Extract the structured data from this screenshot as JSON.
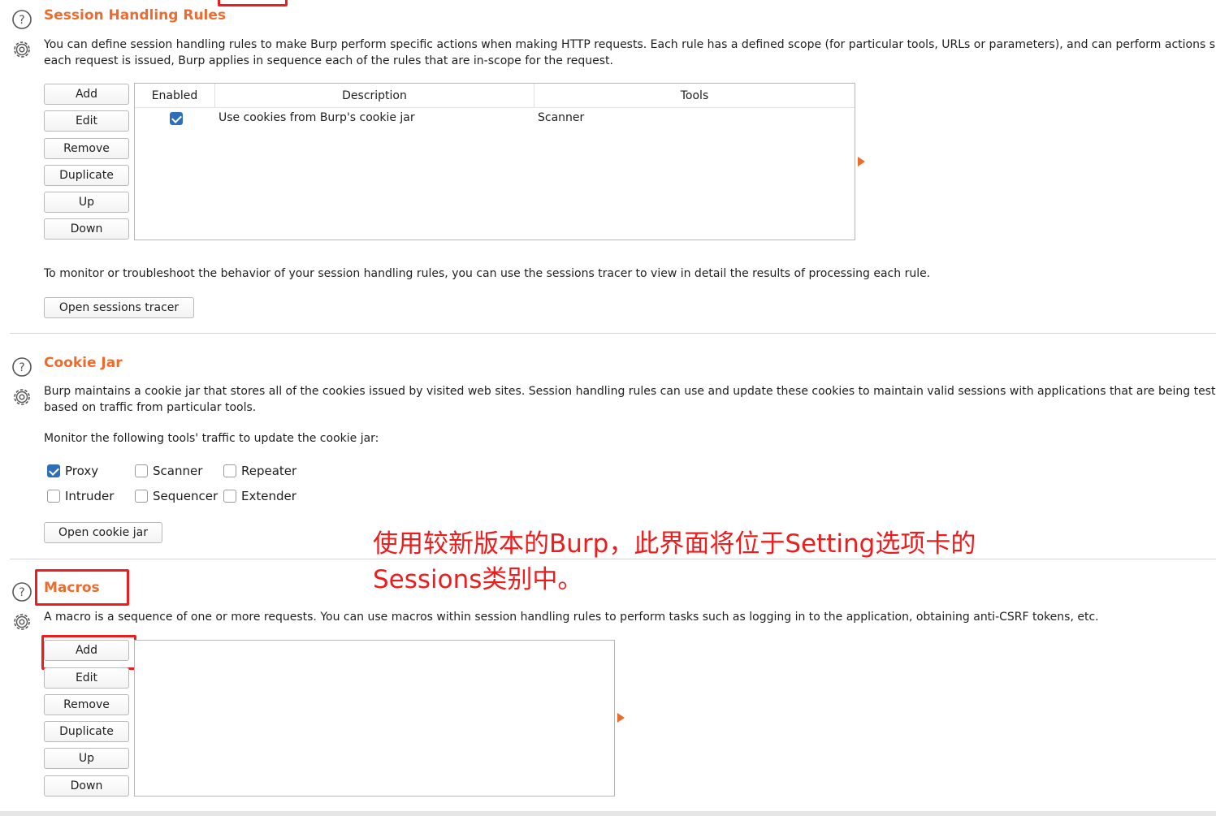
{
  "session_rules": {
    "title": "Session Handling Rules",
    "desc_line1": "You can define session handling rules to make Burp perform specific actions when making HTTP requests. Each rule has a defined scope (for particular tools, URLs or parameters), and can perform actions su",
    "desc_line2": "each request is issued, Burp applies in sequence each of the rules that are in-scope for the request.",
    "buttons": [
      "Add",
      "Edit",
      "Remove",
      "Duplicate",
      "Up",
      "Down"
    ],
    "columns": [
      "Enabled",
      "Description",
      "Tools"
    ],
    "rows": [
      {
        "enabled": true,
        "description": "Use cookies from Burp's cookie jar",
        "tools": "Scanner"
      }
    ],
    "tracer_text": "To monitor or troubleshoot the behavior of your session handling rules, you can use the sessions tracer to view in detail the results of processing each rule.",
    "tracer_button": "Open sessions tracer"
  },
  "cookie_jar": {
    "title": "Cookie Jar",
    "desc_line1": "Burp maintains a cookie jar that stores all of the cookies issued by visited web sites. Session handling rules can use and update these cookies to maintain valid sessions with applications that are being tested",
    "desc_line2": "based on traffic from particular tools.",
    "monitor_label": "Monitor the following tools' traffic to update the cookie jar:",
    "tools": [
      {
        "label": "Proxy",
        "checked": true
      },
      {
        "label": "Scanner",
        "checked": false
      },
      {
        "label": "Repeater",
        "checked": false
      },
      {
        "label": "Intruder",
        "checked": false
      },
      {
        "label": "Sequencer",
        "checked": false
      },
      {
        "label": "Extender",
        "checked": false
      }
    ],
    "open_button": "Open cookie jar"
  },
  "macros": {
    "title": "Macros",
    "desc": "A macro is a sequence of one or more requests. You can use macros within session handling rules to perform tasks such as logging in to the application, obtaining anti-CSRF tokens, etc.",
    "buttons": [
      "Add",
      "Edit",
      "Remove",
      "Duplicate",
      "Up",
      "Down"
    ]
  },
  "annotation": {
    "line1": "使用较新版本的Burp，此界面将位于Setting选项卡的",
    "line2": "Sessions类别中。"
  },
  "colors": {
    "accent": "#ee6b2e",
    "highlight": "#ee1c1c",
    "checkbox": "#2f6fb8"
  },
  "icons": {
    "help": "question-circle-icon",
    "settings": "gear-icon",
    "expand": "triangle-right-icon"
  }
}
